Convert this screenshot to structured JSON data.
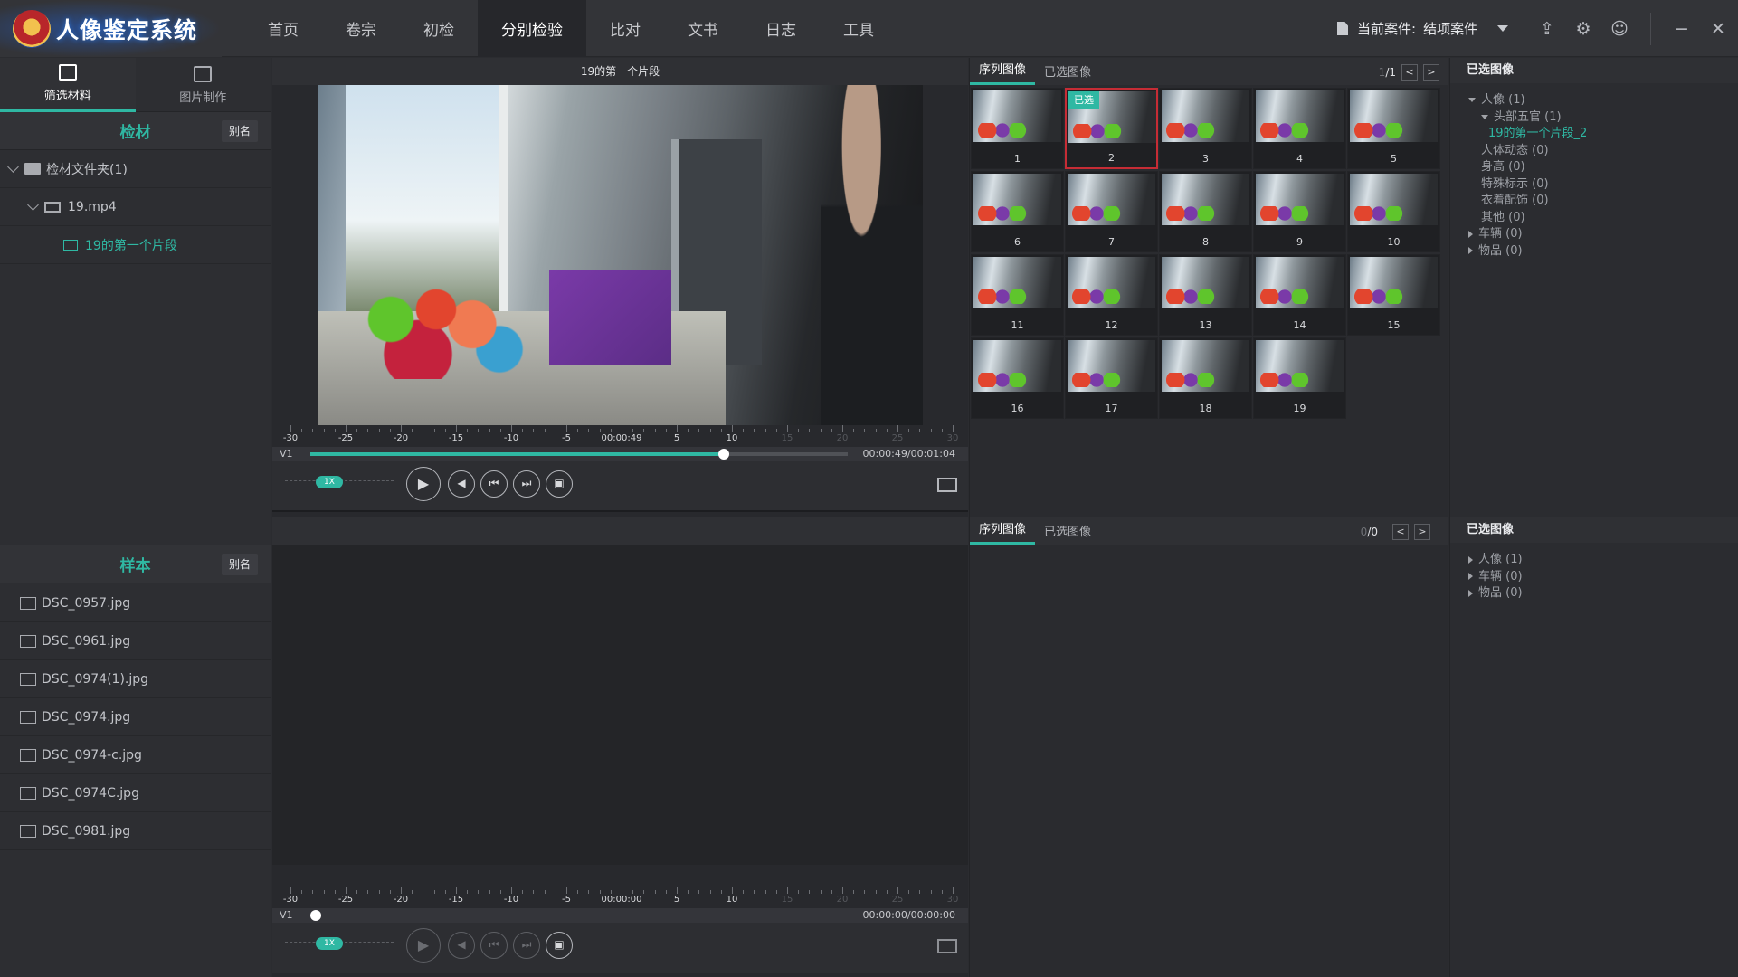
{
  "app": {
    "title": "人像鉴定系统"
  },
  "nav": [
    "首页",
    "卷宗",
    "初检",
    "分别检验",
    "比对",
    "文书",
    "日志",
    "工具"
  ],
  "nav_active": "分别检验",
  "case": {
    "label": "当前案件:",
    "value": "结项案件"
  },
  "left": {
    "tabs": [
      "筛选材料",
      "图片制作"
    ],
    "material": {
      "title": "检材",
      "alias_button": "别名",
      "folder": "检材文件夹(1)",
      "video": "19.mp4",
      "clip": "19的第一个片段"
    },
    "sample": {
      "title": "样本",
      "alias_button": "别名",
      "files": [
        "DSC_0957.jpg",
        "DSC_0961.jpg",
        "DSC_0974(1).jpg",
        "DSC_0974.jpg",
        "DSC_0974-c.jpg",
        "DSC_0974C.jpg",
        "DSC_0981.jpg"
      ]
    }
  },
  "player_top": {
    "title": "19的第一个片段",
    "ruler_labels": [
      "-30",
      "-25",
      "-20",
      "-15",
      "-10",
      "-5",
      "00:00:49",
      "5",
      "10",
      "15",
      "20",
      "25",
      "30"
    ],
    "track_label": "V1",
    "time": "00:00:49/00:01:04",
    "speed": "1X",
    "progress": 0.77
  },
  "player_bottom": {
    "ruler_labels": [
      "-30",
      "-25",
      "-20",
      "-15",
      "-10",
      "-5",
      "00:00:00",
      "5",
      "10",
      "15",
      "20",
      "25",
      "30"
    ],
    "track_label": "V1",
    "time": "00:00:00/00:00:00",
    "speed": "1X"
  },
  "gallery_top": {
    "tabs": [
      "序列图像",
      "已选图像"
    ],
    "page": "1",
    "page_total": "/1",
    "prev": "<",
    "next": ">",
    "thumbs": [
      "1",
      "2",
      "3",
      "4",
      "5",
      "6",
      "7",
      "8",
      "9",
      "10",
      "11",
      "12",
      "13",
      "14",
      "15",
      "16",
      "17",
      "18",
      "19"
    ],
    "selected_index": 1,
    "selected_badge": "已选"
  },
  "gallery_bottom": {
    "tabs": [
      "序列图像",
      "已选图像"
    ],
    "page": "0",
    "page_total": "/0",
    "prev": "<",
    "next": ">"
  },
  "tree_top": {
    "title": "已选图像",
    "nodes": [
      {
        "label": "人像 (1)",
        "level": 0,
        "state": "open"
      },
      {
        "label": "头部五官 (1)",
        "level": 1,
        "state": "open"
      },
      {
        "label": "19的第一个片段_2",
        "level": 2,
        "state": "none",
        "highlight": true
      },
      {
        "label": "人体动态 (0)",
        "level": 1,
        "state": "none"
      },
      {
        "label": "身高 (0)",
        "level": 1,
        "state": "none"
      },
      {
        "label": "特殊标示 (0)",
        "level": 1,
        "state": "none"
      },
      {
        "label": "衣着配饰 (0)",
        "level": 1,
        "state": "none"
      },
      {
        "label": "其他 (0)",
        "level": 1,
        "state": "none"
      },
      {
        "label": "车辆 (0)",
        "level": 0,
        "state": "closed"
      },
      {
        "label": "物品 (0)",
        "level": 0,
        "state": "closed"
      }
    ]
  },
  "tree_bottom": {
    "title": "已选图像",
    "nodes": [
      {
        "label": "人像 (1)",
        "level": 0,
        "state": "closed"
      },
      {
        "label": "车辆 (0)",
        "level": 0,
        "state": "closed"
      },
      {
        "label": "物品 (0)",
        "level": 0,
        "state": "closed"
      }
    ]
  },
  "colors": {
    "accent": "#2fb8a3",
    "selected_border": "#c62c35",
    "background": "#2b2c30"
  }
}
